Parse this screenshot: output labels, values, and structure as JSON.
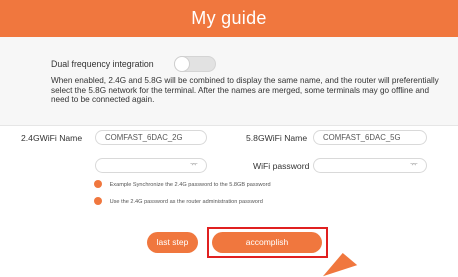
{
  "header": {
    "title": "My guide"
  },
  "dual": {
    "label": "Dual frequency integration",
    "enabled": false,
    "description": "When enabled, 2.4G and 5.8G will be combined to display the same name, and the router will preferentially select the 5.8G network for the terminal. After the names are merged, some terminals may go offline and need to be connected again."
  },
  "wifi24": {
    "label": "2.4GWiFi Name",
    "value": "COMFAST_6DAC_2G",
    "password": ""
  },
  "wifi58": {
    "label": "5.8GWiFi Name",
    "value": "COMFAST_6DAC_5G",
    "password_label": "WiFi password",
    "password": ""
  },
  "options": {
    "sync_label": "Example Synchronize the 2.4G password to the 5.8GB password",
    "admin_label": "Use the 2.4G password as the router administration password"
  },
  "buttons": {
    "back": "last step",
    "finish": "accomplish"
  },
  "icons": {
    "password_toggle": "eye-closed-icon",
    "pointer": "arrow-pointer-icon"
  },
  "colors": {
    "accent": "#f0773e",
    "highlight": "#e02020"
  }
}
